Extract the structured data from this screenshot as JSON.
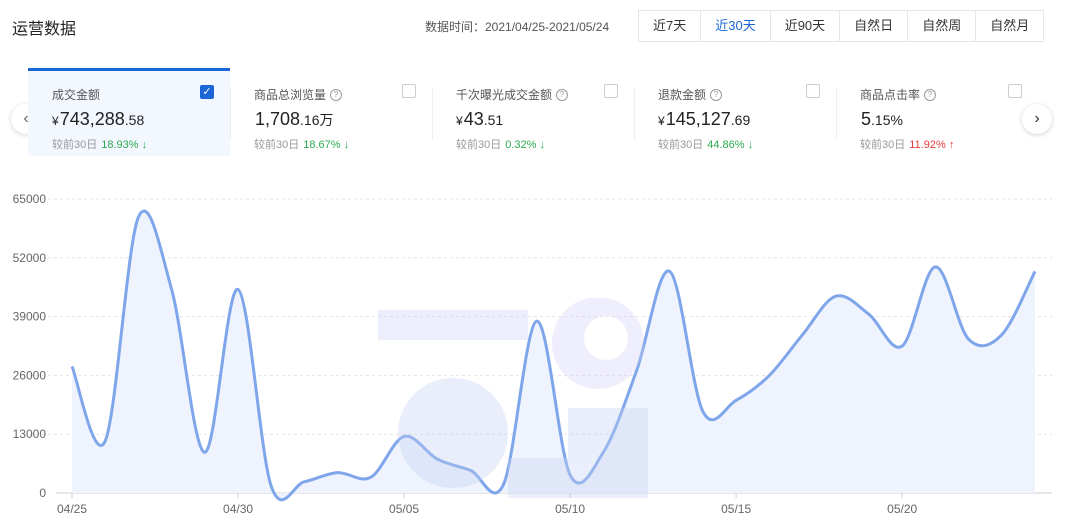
{
  "header": {
    "title": "运营数据",
    "range_label": "数据时间：2021/04/25-2021/05/24",
    "tabs": [
      "近7天",
      "近30天",
      "近90天",
      "自然日",
      "自然周",
      "自然月"
    ],
    "active_tab": "近30天"
  },
  "accent_color": "#1a66d6",
  "up_color": "#e23b3b",
  "down_color": "#2dab4f",
  "metrics": [
    {
      "name": "成交金额",
      "help": false,
      "selected": true,
      "currency": "¥",
      "int": "743,288",
      "dec": ".58",
      "unit": "",
      "compare_label": "较前30日",
      "pct": "18.93%",
      "dir": "down",
      "arrow": "↓"
    },
    {
      "name": "商品总浏览量",
      "help": true,
      "selected": false,
      "currency": "",
      "int": "1,708",
      "dec": ".16万",
      "unit": "",
      "compare_label": "较前30日",
      "pct": "18.67%",
      "dir": "down",
      "arrow": "↓"
    },
    {
      "name": "千次曝光成交金额",
      "help": true,
      "selected": false,
      "currency": "¥",
      "int": "43",
      "dec": ".51",
      "unit": "",
      "compare_label": "较前30日",
      "pct": "0.32%",
      "dir": "down",
      "arrow": "↓"
    },
    {
      "name": "退款金额",
      "help": true,
      "selected": false,
      "currency": "¥",
      "int": "145,127",
      "dec": ".69",
      "unit": "",
      "compare_label": "较前30日",
      "pct": "44.86%",
      "dir": "down",
      "arrow": "↓"
    },
    {
      "name": "商品点击率",
      "help": true,
      "selected": false,
      "currency": "",
      "int": "5",
      "dec": ".15%",
      "unit": "",
      "compare_label": "较前30日",
      "pct": "11.92%",
      "dir": "up",
      "arrow": "↑"
    }
  ],
  "chart_data": {
    "type": "area",
    "x": [
      "04/25",
      "04/26",
      "04/27",
      "04/28",
      "04/29",
      "04/30",
      "05/01",
      "05/02",
      "05/03",
      "05/04",
      "05/05",
      "05/06",
      "05/07",
      "05/08",
      "05/09",
      "05/10",
      "05/11",
      "05/12",
      "05/13",
      "05/14",
      "05/15",
      "05/16",
      "05/17",
      "05/18",
      "05/19",
      "05/20",
      "05/21",
      "05/22",
      "05/23",
      "05/24"
    ],
    "series": [
      {
        "values": [
          28000,
          11500,
          61000,
          45000,
          9000,
          45000,
          1500,
          2500,
          4500,
          3500,
          12500,
          7500,
          5000,
          2000,
          38000,
          4000,
          9000,
          27000,
          49000,
          18000,
          20500,
          26000,
          35000,
          43500,
          39500,
          32500,
          50000,
          34000,
          35000,
          49000
        ]
      }
    ],
    "x_tick_labels": [
      "04/25",
      "04/30",
      "05/05",
      "05/10",
      "05/15",
      "05/20"
    ],
    "y_ticks": [
      0,
      13000,
      26000,
      39000,
      52000,
      65000
    ],
    "ylim": [
      0,
      65000
    ],
    "grid": true,
    "line_color": "#7fa6ea",
    "fill_color": "#eef3fd"
  }
}
